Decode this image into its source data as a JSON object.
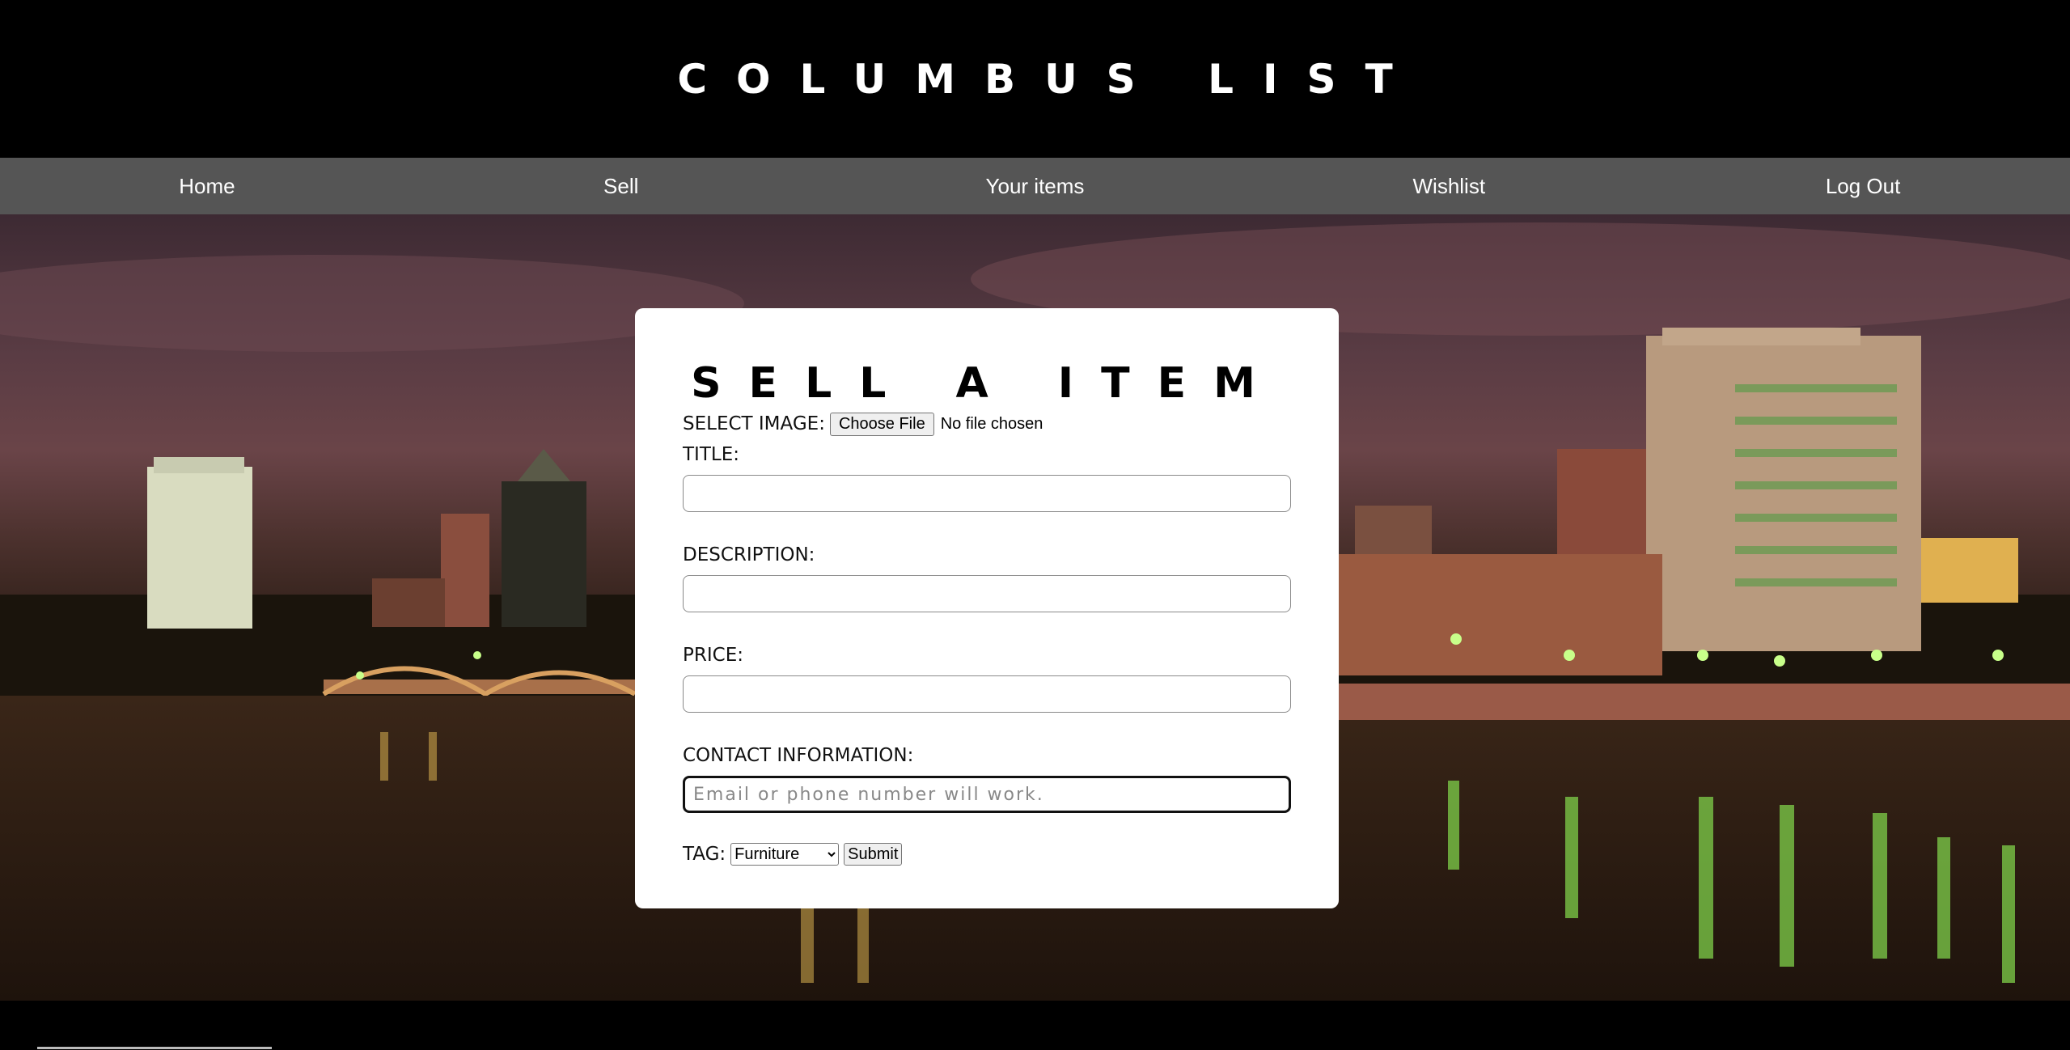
{
  "header": {
    "site_title": "COLUMBUS LIST"
  },
  "nav": {
    "items": [
      {
        "label": "Home"
      },
      {
        "label": "Sell"
      },
      {
        "label": "Your items"
      },
      {
        "label": "Wishlist"
      },
      {
        "label": "Log Out"
      }
    ]
  },
  "form": {
    "title": "SELL A ITEM",
    "image": {
      "label": "SELECT IMAGE:",
      "button": "Choose File",
      "status": "No file chosen"
    },
    "title_field": {
      "label": "TITLE:",
      "value": ""
    },
    "description_field": {
      "label": "DESCRIPTION:",
      "value": ""
    },
    "price_field": {
      "label": "PRICE:",
      "value": ""
    },
    "contact_field": {
      "label": "CONTACT INFORMATION:",
      "value": "",
      "placeholder": "Email or phone number will work."
    },
    "tag": {
      "label": "TAG:",
      "selected": "Furniture"
    },
    "submit_label": "Submit"
  },
  "colors": {
    "topbar": "#000000",
    "nav": "#555555",
    "card": "#ffffff"
  }
}
